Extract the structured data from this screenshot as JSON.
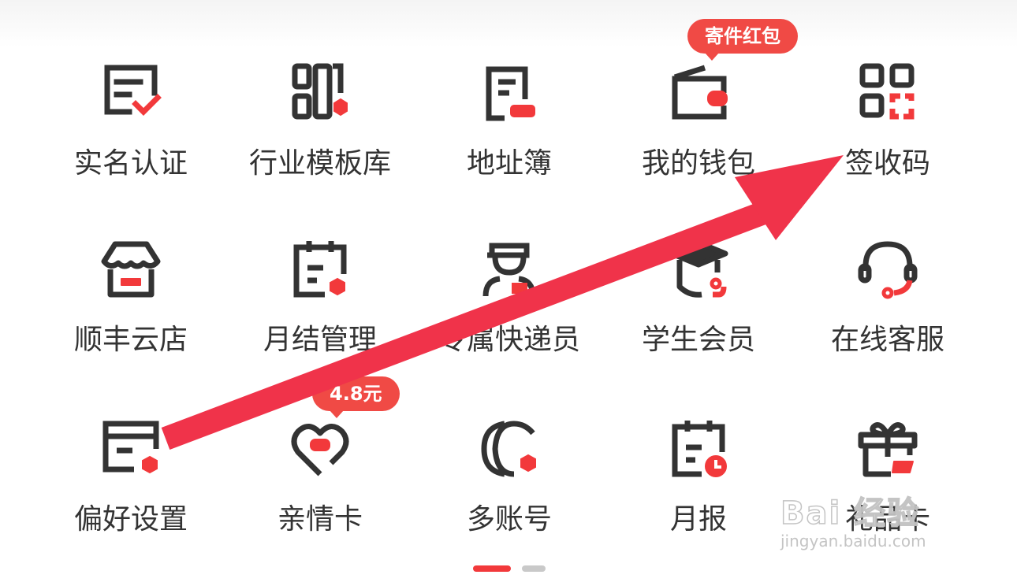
{
  "colors": {
    "accent": "#f2393b",
    "icon_stroke": "#333333",
    "badge": "#f04a45",
    "arrow": "#f0334a"
  },
  "row1": {
    "c1": {
      "label": "实名认证",
      "icon": "certificate-check-icon"
    },
    "c2": {
      "label": "行业模板库",
      "icon": "template-library-icon"
    },
    "c3": {
      "label": "地址簿",
      "icon": "address-book-icon"
    },
    "c4": {
      "label": "我的钱包",
      "icon": "wallet-icon",
      "badge": "寄件红包"
    },
    "c5": {
      "label": "签收码",
      "icon": "qr-code-icon"
    }
  },
  "row2": {
    "c1": {
      "label": "顺丰云店",
      "icon": "store-icon"
    },
    "c2": {
      "label": "月结管理",
      "icon": "monthly-calendar-icon"
    },
    "c3": {
      "label": "专属快递员",
      "icon": "courier-icon"
    },
    "c4": {
      "label": "学生会员",
      "icon": "graduation-cap-icon"
    },
    "c5": {
      "label": "在线客服",
      "icon": "headset-icon"
    }
  },
  "row3": {
    "c1": {
      "label": "偏好设置",
      "icon": "preference-card-icon"
    },
    "c2": {
      "label": "亲情卡",
      "icon": "heart-card-icon",
      "badge": "4.8元"
    },
    "c3": {
      "label": "多账号",
      "icon": "multi-account-icon"
    },
    "c4": {
      "label": "月报",
      "icon": "monthly-report-icon"
    },
    "c5": {
      "label": "礼品卡",
      "icon": "gift-card-icon"
    }
  },
  "watermark": {
    "main": "Bai 经验",
    "sub": "jingyan.baidu.com"
  }
}
